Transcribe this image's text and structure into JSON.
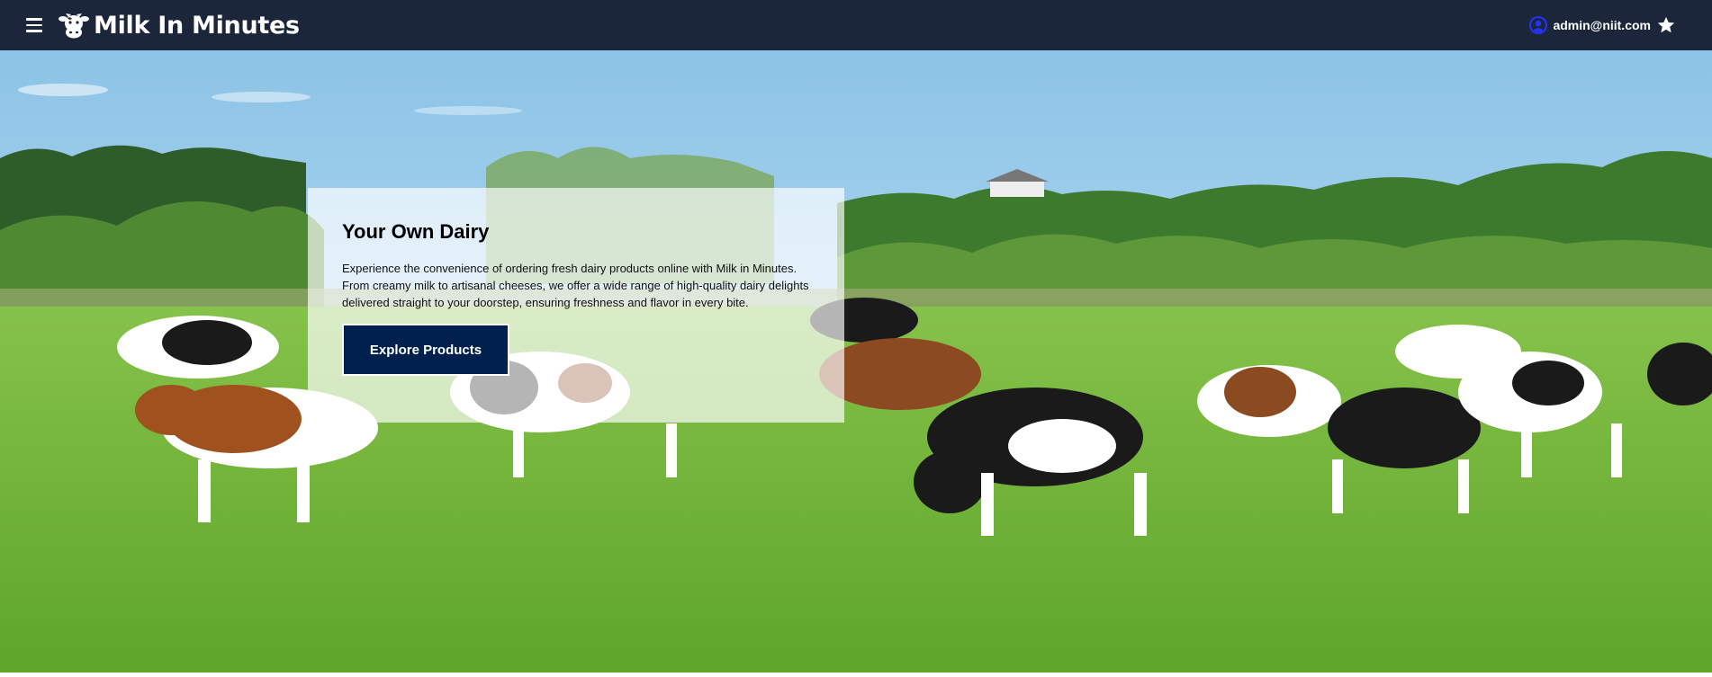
{
  "app": {
    "title": "Milk In Minutes",
    "logo_icon": "cow-head-icon",
    "menu_icon": "hamburger-menu-icon"
  },
  "user": {
    "email": "admin@niit.com",
    "avatar_icon": "user-circle-icon",
    "favorite_icon": "star-icon"
  },
  "hero": {
    "title": "Your Own Dairy",
    "description": "Experience the convenience of ordering fresh dairy products online with Milk in Minutes. From creamy milk to artisanal cheeses, we offer a wide range of high-quality dairy delights delivered straight to your doorstep, ensuring freshness and flavor in every bite.",
    "cta_label": "Explore Products"
  },
  "colors": {
    "navbar": "#1b263b",
    "cta_background": "#00204e",
    "user_icon": "#2233ff"
  }
}
